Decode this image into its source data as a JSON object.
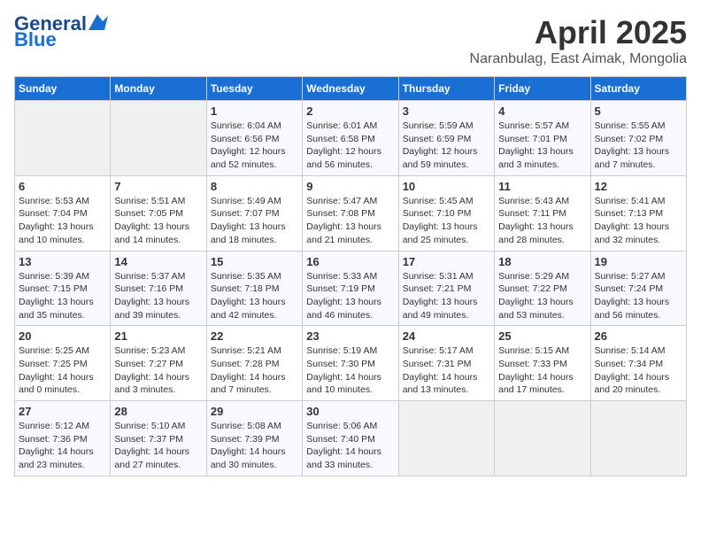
{
  "logo": {
    "line1": "General",
    "line2": "Blue"
  },
  "title": "April 2025",
  "location": "Naranbulag, East Aimak, Mongolia",
  "days_of_week": [
    "Sunday",
    "Monday",
    "Tuesday",
    "Wednesday",
    "Thursday",
    "Friday",
    "Saturday"
  ],
  "weeks": [
    [
      {
        "day": "",
        "info": ""
      },
      {
        "day": "",
        "info": ""
      },
      {
        "day": "1",
        "info": "Sunrise: 6:04 AM\nSunset: 6:56 PM\nDaylight: 12 hours\nand 52 minutes."
      },
      {
        "day": "2",
        "info": "Sunrise: 6:01 AM\nSunset: 6:58 PM\nDaylight: 12 hours\nand 56 minutes."
      },
      {
        "day": "3",
        "info": "Sunrise: 5:59 AM\nSunset: 6:59 PM\nDaylight: 12 hours\nand 59 minutes."
      },
      {
        "day": "4",
        "info": "Sunrise: 5:57 AM\nSunset: 7:01 PM\nDaylight: 13 hours\nand 3 minutes."
      },
      {
        "day": "5",
        "info": "Sunrise: 5:55 AM\nSunset: 7:02 PM\nDaylight: 13 hours\nand 7 minutes."
      }
    ],
    [
      {
        "day": "6",
        "info": "Sunrise: 5:53 AM\nSunset: 7:04 PM\nDaylight: 13 hours\nand 10 minutes."
      },
      {
        "day": "7",
        "info": "Sunrise: 5:51 AM\nSunset: 7:05 PM\nDaylight: 13 hours\nand 14 minutes."
      },
      {
        "day": "8",
        "info": "Sunrise: 5:49 AM\nSunset: 7:07 PM\nDaylight: 13 hours\nand 18 minutes."
      },
      {
        "day": "9",
        "info": "Sunrise: 5:47 AM\nSunset: 7:08 PM\nDaylight: 13 hours\nand 21 minutes."
      },
      {
        "day": "10",
        "info": "Sunrise: 5:45 AM\nSunset: 7:10 PM\nDaylight: 13 hours\nand 25 minutes."
      },
      {
        "day": "11",
        "info": "Sunrise: 5:43 AM\nSunset: 7:11 PM\nDaylight: 13 hours\nand 28 minutes."
      },
      {
        "day": "12",
        "info": "Sunrise: 5:41 AM\nSunset: 7:13 PM\nDaylight: 13 hours\nand 32 minutes."
      }
    ],
    [
      {
        "day": "13",
        "info": "Sunrise: 5:39 AM\nSunset: 7:15 PM\nDaylight: 13 hours\nand 35 minutes."
      },
      {
        "day": "14",
        "info": "Sunrise: 5:37 AM\nSunset: 7:16 PM\nDaylight: 13 hours\nand 39 minutes."
      },
      {
        "day": "15",
        "info": "Sunrise: 5:35 AM\nSunset: 7:18 PM\nDaylight: 13 hours\nand 42 minutes."
      },
      {
        "day": "16",
        "info": "Sunrise: 5:33 AM\nSunset: 7:19 PM\nDaylight: 13 hours\nand 46 minutes."
      },
      {
        "day": "17",
        "info": "Sunrise: 5:31 AM\nSunset: 7:21 PM\nDaylight: 13 hours\nand 49 minutes."
      },
      {
        "day": "18",
        "info": "Sunrise: 5:29 AM\nSunset: 7:22 PM\nDaylight: 13 hours\nand 53 minutes."
      },
      {
        "day": "19",
        "info": "Sunrise: 5:27 AM\nSunset: 7:24 PM\nDaylight: 13 hours\nand 56 minutes."
      }
    ],
    [
      {
        "day": "20",
        "info": "Sunrise: 5:25 AM\nSunset: 7:25 PM\nDaylight: 14 hours\nand 0 minutes."
      },
      {
        "day": "21",
        "info": "Sunrise: 5:23 AM\nSunset: 7:27 PM\nDaylight: 14 hours\nand 3 minutes."
      },
      {
        "day": "22",
        "info": "Sunrise: 5:21 AM\nSunset: 7:28 PM\nDaylight: 14 hours\nand 7 minutes."
      },
      {
        "day": "23",
        "info": "Sunrise: 5:19 AM\nSunset: 7:30 PM\nDaylight: 14 hours\nand 10 minutes."
      },
      {
        "day": "24",
        "info": "Sunrise: 5:17 AM\nSunset: 7:31 PM\nDaylight: 14 hours\nand 13 minutes."
      },
      {
        "day": "25",
        "info": "Sunrise: 5:15 AM\nSunset: 7:33 PM\nDaylight: 14 hours\nand 17 minutes."
      },
      {
        "day": "26",
        "info": "Sunrise: 5:14 AM\nSunset: 7:34 PM\nDaylight: 14 hours\nand 20 minutes."
      }
    ],
    [
      {
        "day": "27",
        "info": "Sunrise: 5:12 AM\nSunset: 7:36 PM\nDaylight: 14 hours\nand 23 minutes."
      },
      {
        "day": "28",
        "info": "Sunrise: 5:10 AM\nSunset: 7:37 PM\nDaylight: 14 hours\nand 27 minutes."
      },
      {
        "day": "29",
        "info": "Sunrise: 5:08 AM\nSunset: 7:39 PM\nDaylight: 14 hours\nand 30 minutes."
      },
      {
        "day": "30",
        "info": "Sunrise: 5:06 AM\nSunset: 7:40 PM\nDaylight: 14 hours\nand 33 minutes."
      },
      {
        "day": "",
        "info": ""
      },
      {
        "day": "",
        "info": ""
      },
      {
        "day": "",
        "info": ""
      }
    ]
  ]
}
